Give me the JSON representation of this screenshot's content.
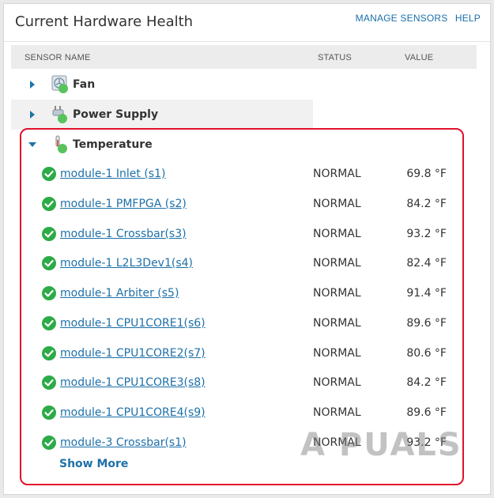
{
  "header": {
    "title": "Current Hardware Health",
    "links": [
      {
        "label": "MANAGE SENSORS"
      },
      {
        "label": "HELP"
      }
    ]
  },
  "columns": {
    "name": "SENSOR NAME",
    "status": "STATUS",
    "value": "VALUE"
  },
  "groups": [
    {
      "label": "Fan",
      "expanded": false,
      "icon": "fan-icon"
    },
    {
      "label": "Power Supply",
      "expanded": false,
      "icon": "power-supply-icon"
    },
    {
      "label": "Temperature",
      "expanded": true,
      "icon": "thermometer-icon"
    }
  ],
  "sensors": [
    {
      "name": "module-1 Inlet (s1)",
      "status": "NORMAL",
      "value": "69.8 °F"
    },
    {
      "name": "module-1 PMFPGA (s2)",
      "status": "NORMAL",
      "value": "84.2 °F"
    },
    {
      "name": "module-1 Crossbar(s3)",
      "status": "NORMAL",
      "value": "93.2 °F"
    },
    {
      "name": "module-1 L2L3Dev1(s4)",
      "status": "NORMAL",
      "value": "82.4 °F"
    },
    {
      "name": "module-1 Arbiter (s5)",
      "status": "NORMAL",
      "value": "91.4 °F"
    },
    {
      "name": "module-1 CPU1CORE1(s6)",
      "status": "NORMAL",
      "value": "89.6 °F"
    },
    {
      "name": "module-1 CPU1CORE2(s7)",
      "status": "NORMAL",
      "value": "80.6 °F"
    },
    {
      "name": "module-1 CPU1CORE3(s8)",
      "status": "NORMAL",
      "value": "84.2 °F"
    },
    {
      "name": "module-1 CPU1CORE4(s9)",
      "status": "NORMAL",
      "value": "89.6 °F"
    },
    {
      "name": "module-3 Crossbar(s1)",
      "status": "NORMAL",
      "value": "93.2 °F"
    }
  ],
  "show_more": "Show More",
  "watermark": "A PUALS",
  "colors": {
    "link": "#1d70a8",
    "ok": "#2cab47",
    "highlight": "#e0112b"
  }
}
